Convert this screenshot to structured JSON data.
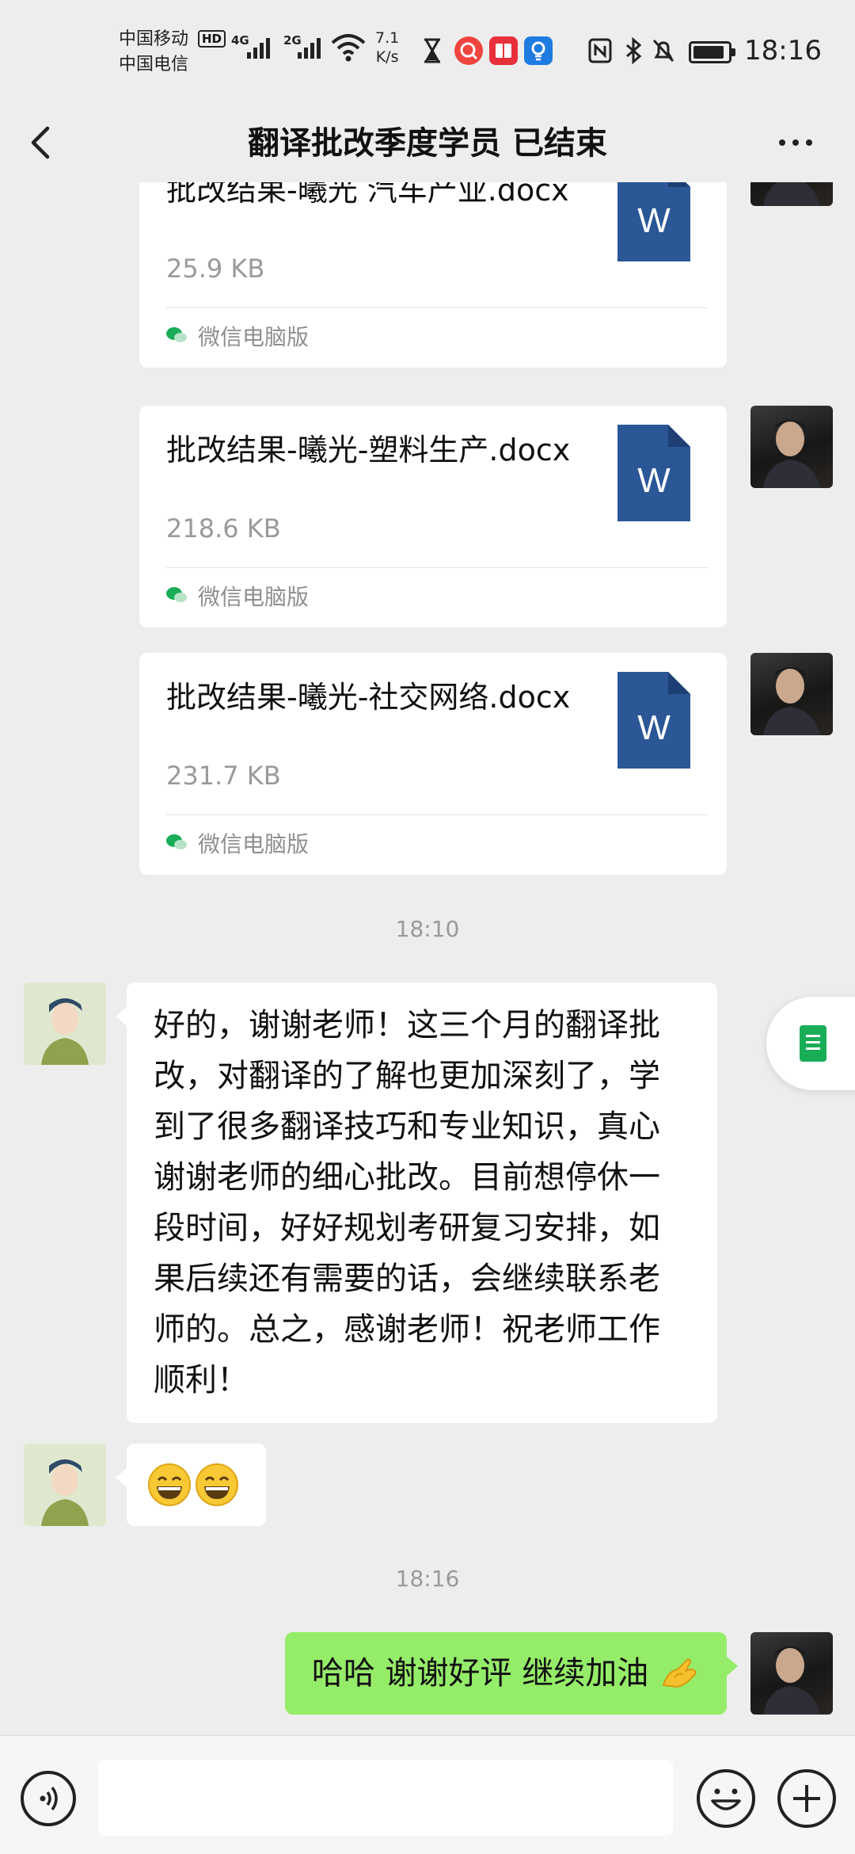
{
  "status_bar": {
    "carrier_1": "中国移动",
    "carrier_2": "中国电信",
    "hd_badge": "HD",
    "net_1": "4G",
    "net_2": "2G",
    "speed_value": "7.1",
    "speed_unit": "K/s",
    "time": "18:16",
    "icons": [
      "hourglass-icon",
      "search-app-icon",
      "reader-app-icon",
      "bulb-app-icon",
      "nfc-icon",
      "bluetooth-icon",
      "mute-bell-icon",
      "battery-icon"
    ]
  },
  "nav": {
    "title": "翻译批改季度学员 已结束",
    "back_icon": "chevron-left-icon",
    "more_icon": "more-dots-icon"
  },
  "messages": {
    "files": [
      {
        "name": "批改结果-曦光 汽车产业.docx",
        "size": "25.9 KB",
        "source": "微信电脑版",
        "icon": "word-doc-icon",
        "icon_letter": "W"
      },
      {
        "name": "批改结果-曦光-塑料生产.docx",
        "size": "218.6 KB",
        "source": "微信电脑版",
        "icon": "word-doc-icon",
        "icon_letter": "W"
      },
      {
        "name": "批改结果-曦光-社交网络.docx",
        "size": "231.7 KB",
        "source": "微信电脑版",
        "icon": "word-doc-icon",
        "icon_letter": "W"
      }
    ],
    "timestamp_1": "18:10",
    "student_message": "好的，谢谢老师！这三个月的翻译批改，对翻译的了解也更加深刻了，学到了很多翻译技巧和专业知识，真心谢谢老师的细心批改。目前想停休一段时间，好好规划考研复习安排，如果后续还有需要的话，会继续联系老师的。总之，感谢老师！祝老师工作顺利！",
    "student_emoji": "grinning-emoji-x2",
    "timestamp_2": "18:16",
    "teacher_reply": "哈哈 谢谢好评 继续加油",
    "teacher_reply_emoji": "ok-hand-emoji"
  },
  "input_bar": {
    "voice_icon": "voice-icon",
    "input_value": "",
    "emoji_icon": "smiley-icon",
    "plus_icon": "plus-circle-icon"
  },
  "colors": {
    "background": "#ededed",
    "outgoing_bubble": "#95ec69",
    "incoming_bubble": "#ffffff",
    "word_blue": "#2b5797",
    "wechat_green": "#1aad57"
  }
}
